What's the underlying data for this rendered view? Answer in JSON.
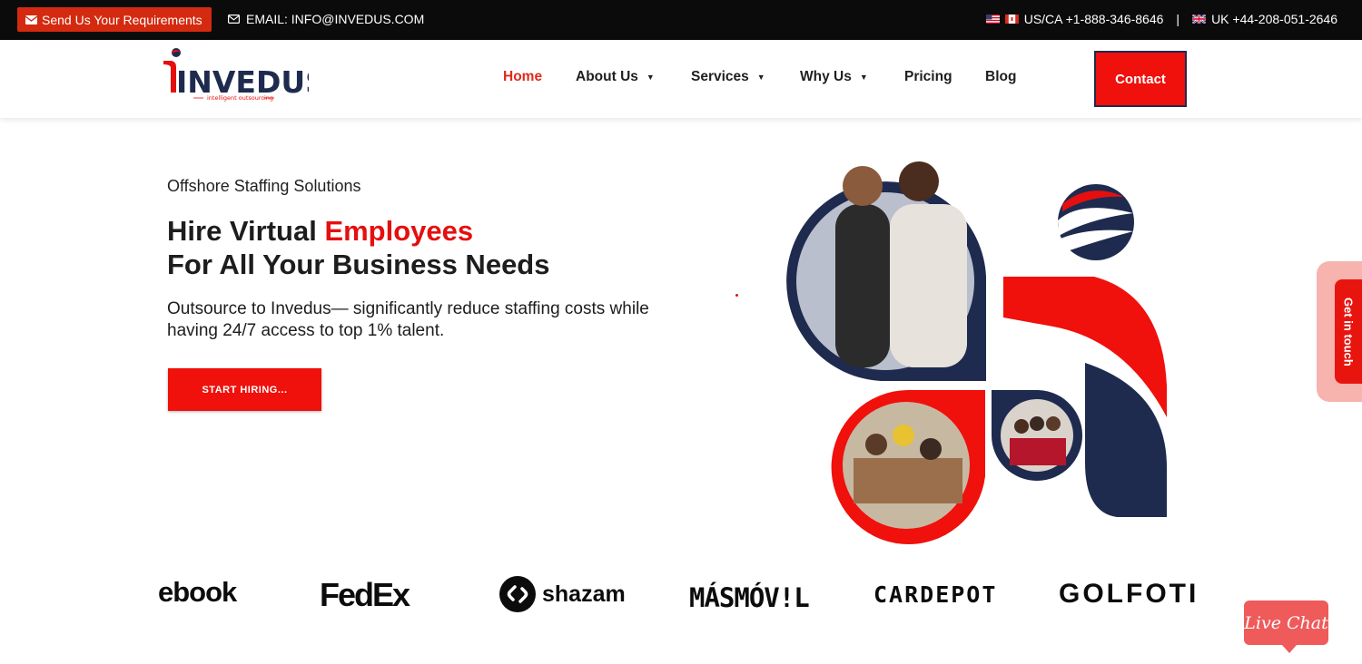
{
  "topbar": {
    "requirements_label": "Send Us Your Requirements",
    "email_label": "EMAIL: INFO@INVEDUS.COM",
    "phone_us": "US/CA +1-888-346-8646",
    "separator": "|",
    "phone_uk": "UK +44-208-051-2646"
  },
  "header": {
    "logo_text": "INVEDUS",
    "logo_tagline": "intelligent outsourcing",
    "nav": [
      {
        "label": "Home",
        "active": true
      },
      {
        "label": "About Us",
        "dropdown": true
      },
      {
        "label": "Services",
        "dropdown": true
      },
      {
        "label": "Why Us",
        "dropdown": true
      },
      {
        "label": "Pricing"
      },
      {
        "label": "Blog"
      }
    ],
    "contact_label": "Contact"
  },
  "hero": {
    "eyebrow": "Offshore Staffing Solutions",
    "headline_part1": "Hire Virtual ",
    "headline_highlight": "Employees",
    "headline_line2": "For All Your Business Needs",
    "description": "Outsource to Invedus— significantly reduce staffing costs while having 24/7 access to top 1% talent.",
    "cta_label": "START HIRING..."
  },
  "side_tab": {
    "label": "Get in touch"
  },
  "client_logos": [
    "ebook",
    "FedEx",
    "shazam",
    "MÁSMÓV!L",
    "CARDEPOT",
    "GOLFOTI"
  ],
  "live_chat": {
    "label": "Live Chat"
  },
  "colors": {
    "brand_red": "#f0100c",
    "brand_navy": "#1e2b4f",
    "topbar": "#0b0b0b",
    "accent_red": "#e02a1c"
  }
}
